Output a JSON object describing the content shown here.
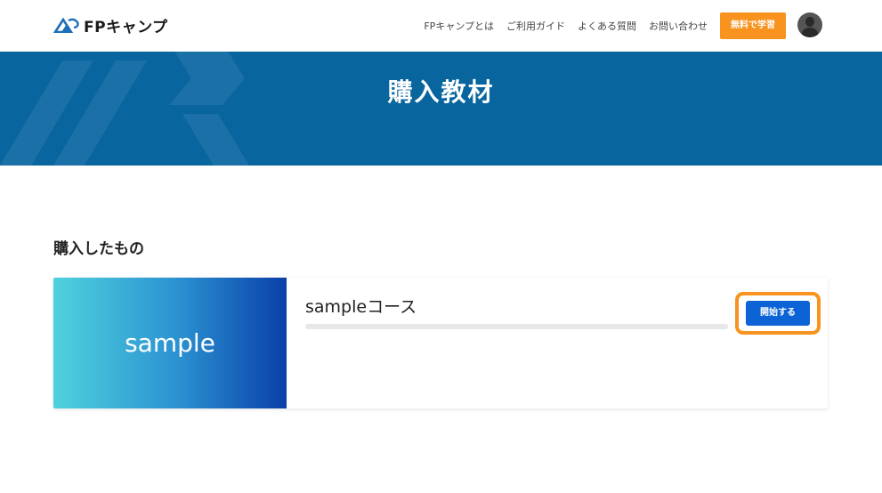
{
  "header": {
    "logo_text": "FPキャンプ",
    "nav": [
      {
        "label": "FPキャンプとは"
      },
      {
        "label": "ご利用ガイド"
      },
      {
        "label": "よくある質問"
      },
      {
        "label": "お問い合わせ"
      }
    ],
    "cta_label": "無料で学習"
  },
  "hero": {
    "title": "購入教材"
  },
  "purchased": {
    "section_title": "購入したもの",
    "courses": [
      {
        "thumbnail_text": "sample",
        "title": "sampleコース",
        "progress": 0,
        "start_label": "開始する"
      }
    ]
  },
  "colors": {
    "brand_blue": "#08659d",
    "cta_orange": "#f7931e",
    "button_blue": "#0b63d6"
  },
  "icons": {
    "logo": "mountain-logo-icon",
    "avatar": "user-avatar-icon"
  }
}
